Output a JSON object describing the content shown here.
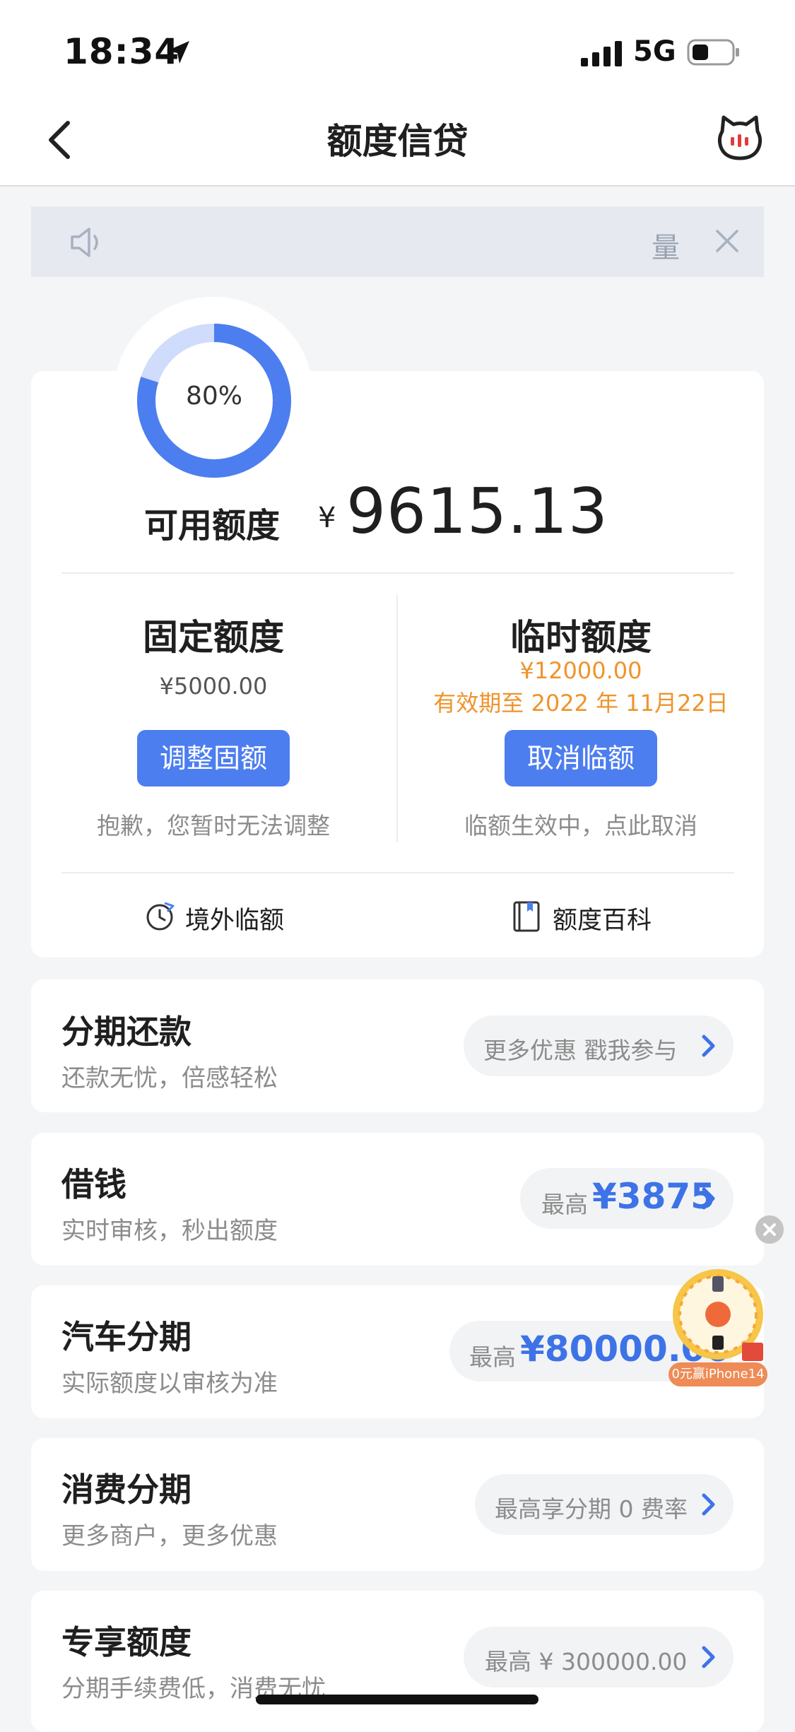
{
  "status": {
    "time": "18:34",
    "network": "5G"
  },
  "nav": {
    "title": "额度信贷"
  },
  "notice": {
    "mark": "量"
  },
  "credit": {
    "percent_label": "80%",
    "available_fraction": 0.8,
    "available_label": "可用额度",
    "currency": "¥",
    "available_amount": "9615.13",
    "fixed": {
      "title": "固定额度",
      "amount": "¥5000.00",
      "button": "调整固额",
      "note": "抱歉，您暂时无法调整"
    },
    "temp": {
      "title": "临时额度",
      "amount": "¥12000.00",
      "validity": "有效期至 2022 年 11月22日",
      "button": "取消临额",
      "note": "临额生效中，点此取消"
    },
    "utils": [
      {
        "label": "境外临额",
        "icon": "plane-clock-icon"
      },
      {
        "label": "额度百科",
        "icon": "book-icon"
      }
    ]
  },
  "services": [
    {
      "title": "分期还款",
      "subtitle": "还款无忧，倍感轻松",
      "pill_text": "更多优惠 戳我参与",
      "pill_prefix": "",
      "pill_value": ""
    },
    {
      "title": "借钱",
      "subtitle": "实时审核，秒出额度",
      "pill_text": "",
      "pill_prefix": "最高",
      "pill_value": "¥3875"
    },
    {
      "title": "汽车分期",
      "subtitle": "实际额度以审核为准",
      "pill_text": "",
      "pill_prefix": "最高",
      "pill_value": "¥80000.00"
    },
    {
      "title": "消费分期",
      "subtitle": "更多商户，更多优惠",
      "pill_text": "最高享分期 0 费率",
      "pill_prefix": "",
      "pill_value": ""
    },
    {
      "title": "专享额度",
      "subtitle": "分期手续费低，消费无忧",
      "pill_text": "最高 ¥ 300000.00",
      "pill_prefix": "",
      "pill_value": ""
    }
  ],
  "floating": {
    "label": "0元赢iPhone14"
  },
  "colors": {
    "accent": "#4d7ef0",
    "orange": "#f0932b",
    "ring_light": "#cfdcfb"
  }
}
